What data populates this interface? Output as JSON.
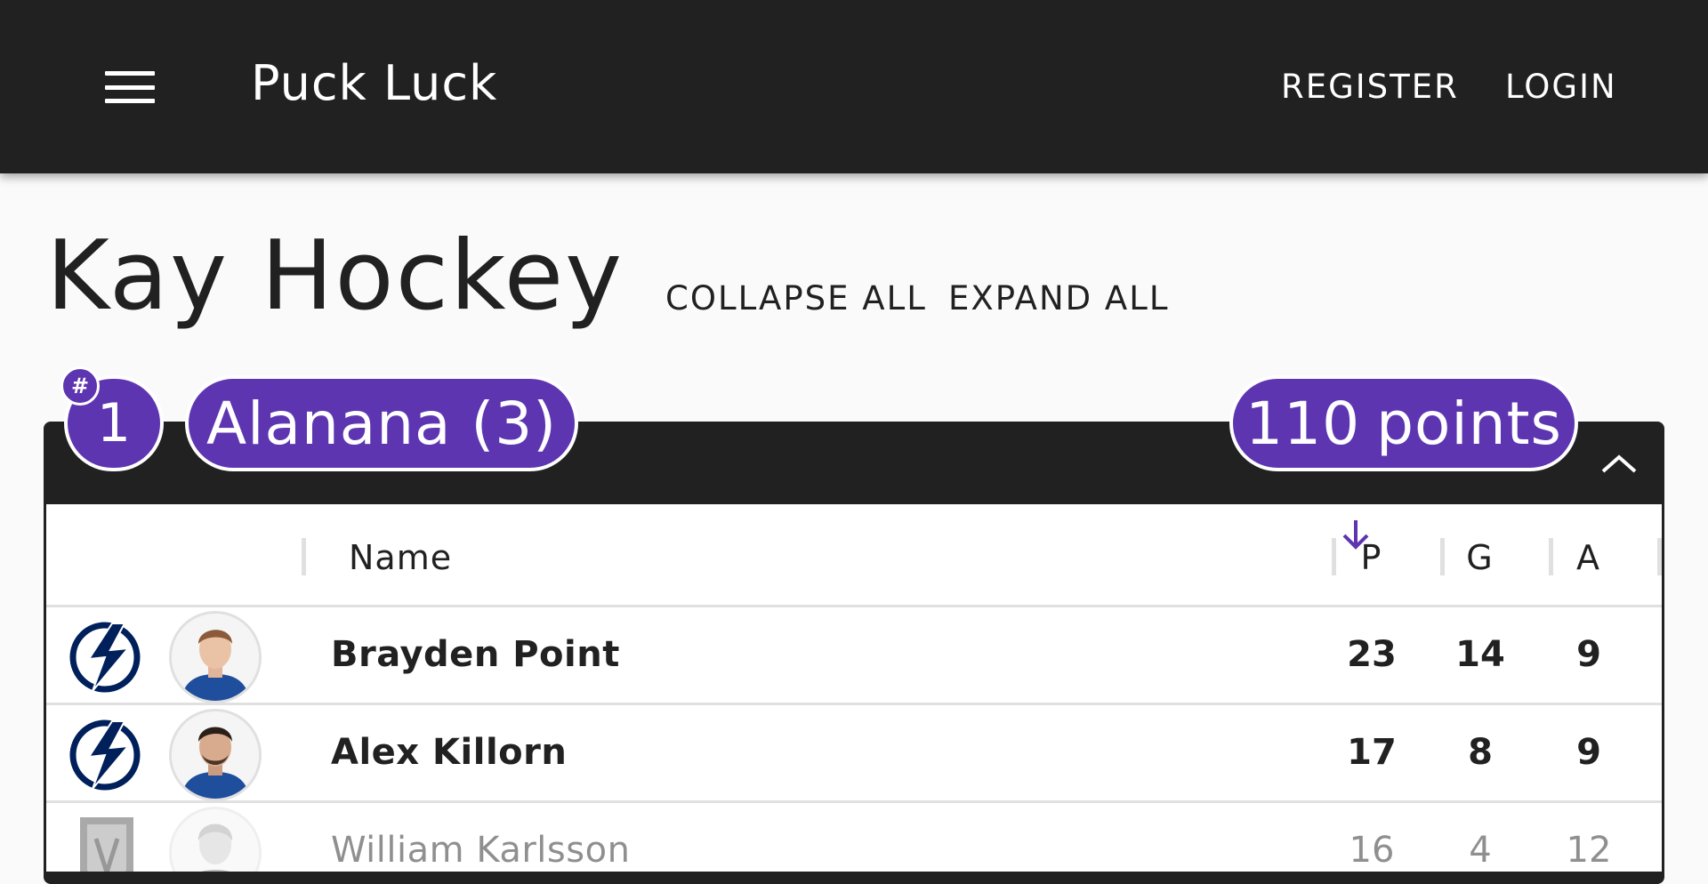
{
  "app": {
    "title": "Puck Luck",
    "menu_icon": "hamburger-menu-icon",
    "nav": {
      "register": "REGISTER",
      "login": "LOGIN"
    }
  },
  "page": {
    "title": "Kay Hockey",
    "collapse_all": "COLLAPSE ALL",
    "expand_all": "EXPAND ALL"
  },
  "team_card": {
    "rank_marker": "#",
    "rank": "1",
    "team_name": "Alanana (3)",
    "points_value": "110",
    "points_label": "points",
    "toggle_icon": "chevron-up-icon",
    "accent_color": "#5e35b1"
  },
  "roster_table": {
    "columns": {
      "name": "Name",
      "points": "P",
      "goals": "G",
      "assists": "A"
    },
    "sorted_by": "P",
    "sort_icon": "arrow-down-icon",
    "rows": [
      {
        "team_icon": "lightning-logo-icon",
        "name": "Brayden Point",
        "p": "23",
        "g": "14",
        "a": "9",
        "dimmed": false
      },
      {
        "team_icon": "lightning-logo-icon",
        "name": "Alex Killorn",
        "p": "17",
        "g": "8",
        "a": "9",
        "dimmed": false
      },
      {
        "team_icon": "knights-helmet-logo-icon",
        "name": "William Karlsson",
        "p": "16",
        "g": "4",
        "a": "12",
        "dimmed": true
      }
    ]
  }
}
